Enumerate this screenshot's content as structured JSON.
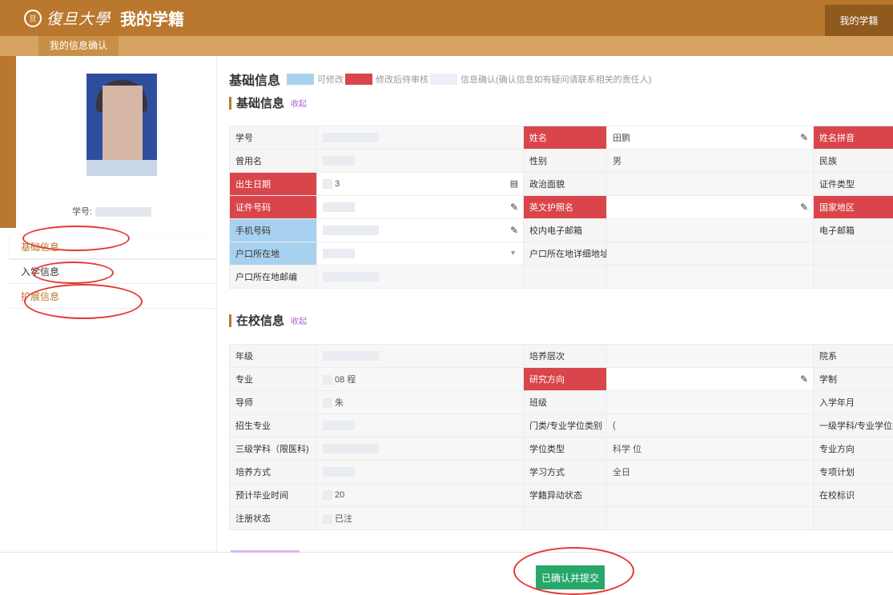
{
  "header": {
    "seal_text": "旦",
    "university_name": "復旦大學",
    "app_title": "我的学籍",
    "top_tab": "我的学籍",
    "subtitle": "我的信息确认"
  },
  "sidebar": {
    "student_no_label": "学号:",
    "nav": [
      {
        "label": "基础信息"
      },
      {
        "label": "入学信息"
      },
      {
        "label": "扩展信息"
      }
    ]
  },
  "legend": {
    "title": "基础信息",
    "items": [
      {
        "color": "#a8d1f0",
        "label": "可修改"
      },
      {
        "color": "#d9454a",
        "label": "修改后待审核"
      },
      {
        "color": "#eeeef8",
        "label": "信息确认(确认信息如有疑问请联系相关的责任人)"
      }
    ]
  },
  "sections": {
    "basic": {
      "title": "基础信息",
      "collapse": "收起"
    },
    "school": {
      "title": "在校信息",
      "collapse": "收起"
    }
  },
  "basic_rows": [
    {
      "c1": "学号",
      "c1s": "",
      "v1": "",
      "c2": "姓名",
      "c2s": "red",
      "v2": "田鹏",
      "e2": "pencil",
      "c3": "姓名拼音",
      "c3s": "red"
    },
    {
      "c1": "曾用名",
      "c1s": "",
      "v1": "",
      "c2": "性别",
      "c2s": "",
      "v2": "男",
      "e2": "",
      "c3": "民族",
      "c3s": ""
    },
    {
      "c1": "出生日期",
      "c1s": "red",
      "v1": "3",
      "e1": "cal",
      "c2": "政治面貌",
      "c2s": "",
      "v2": "",
      "e2": "",
      "c3": "证件类型",
      "c3s": ""
    },
    {
      "c1": "证件号码",
      "c1s": "red",
      "v1": "",
      "e1": "pencil",
      "c2": "英文护照名",
      "c2s": "red",
      "v2": "",
      "e2": "pencil",
      "c3": "国家地区",
      "c3s": "red"
    },
    {
      "c1": "手机号码",
      "c1s": "blue",
      "v1": "",
      "e1": "pencil",
      "c2": "校内电子邮箱",
      "c2s": "",
      "v2": "",
      "e2": "",
      "c3": "电子邮箱",
      "c3s": ""
    },
    {
      "c1": "户口所在地",
      "c1s": "blue",
      "v1": "",
      "e1": "caret",
      "c2": "户口所在地详细地址",
      "c2s": "",
      "v2": "",
      "e2": "",
      "c3": "",
      "c3s": ""
    },
    {
      "c1": "户口所在地邮编",
      "c1s": "",
      "v1": "",
      "c2": "",
      "c2s": "",
      "v2": "",
      "e2": "",
      "c3": "",
      "c3s": ""
    }
  ],
  "school_rows": [
    {
      "c1": "年级",
      "c1s": "",
      "v1": "",
      "c2": "培养层次",
      "c2s": "",
      "v2": "",
      "e2": "",
      "c3": "院系",
      "c3s": ""
    },
    {
      "c1": "专业",
      "c1s": "",
      "v1": "08 程",
      "c2": "研究方向",
      "c2s": "red",
      "v2": "",
      "e2": "pencil",
      "c3": "学制",
      "c3s": ""
    },
    {
      "c1": "导师",
      "c1s": "",
      "v1": "朱",
      "c2": "班级",
      "c2s": "",
      "v2": "",
      "e2": "",
      "c3": "入学年月",
      "c3s": ""
    },
    {
      "c1": "招生专业",
      "c1s": "",
      "v1": "",
      "c2": "门类/专业学位类别",
      "c2s": "",
      "v2": "(",
      "e2": "",
      "c3": "一级学科/专业学位类别",
      "c3s": ""
    },
    {
      "c1": "三级学科（限医科)",
      "c1s": "",
      "v1": "",
      "c2": "学位类型",
      "c2s": "",
      "v2": "科学 位",
      "e2": "",
      "c3": "专业方向",
      "c3s": ""
    },
    {
      "c1": "培养方式",
      "c1s": "",
      "v1": "",
      "c2": "学习方式",
      "c2s": "",
      "v2": "全日",
      "e2": "",
      "c3": "专项计划",
      "c3s": ""
    },
    {
      "c1": "预计毕业时间",
      "c1s": "",
      "v1": "20",
      "c2": "学籍异动状态",
      "c2s": "",
      "v2": "",
      "e2": "",
      "c3": "在校标识",
      "c3s": ""
    },
    {
      "c1": "注册状态",
      "c1s": "",
      "v1": "已注",
      "c2": "",
      "c2s": "",
      "v2": "",
      "e2": "",
      "c3": "",
      "c3s": ""
    }
  ],
  "footer": {
    "confirm_button": "已确认并提交"
  }
}
